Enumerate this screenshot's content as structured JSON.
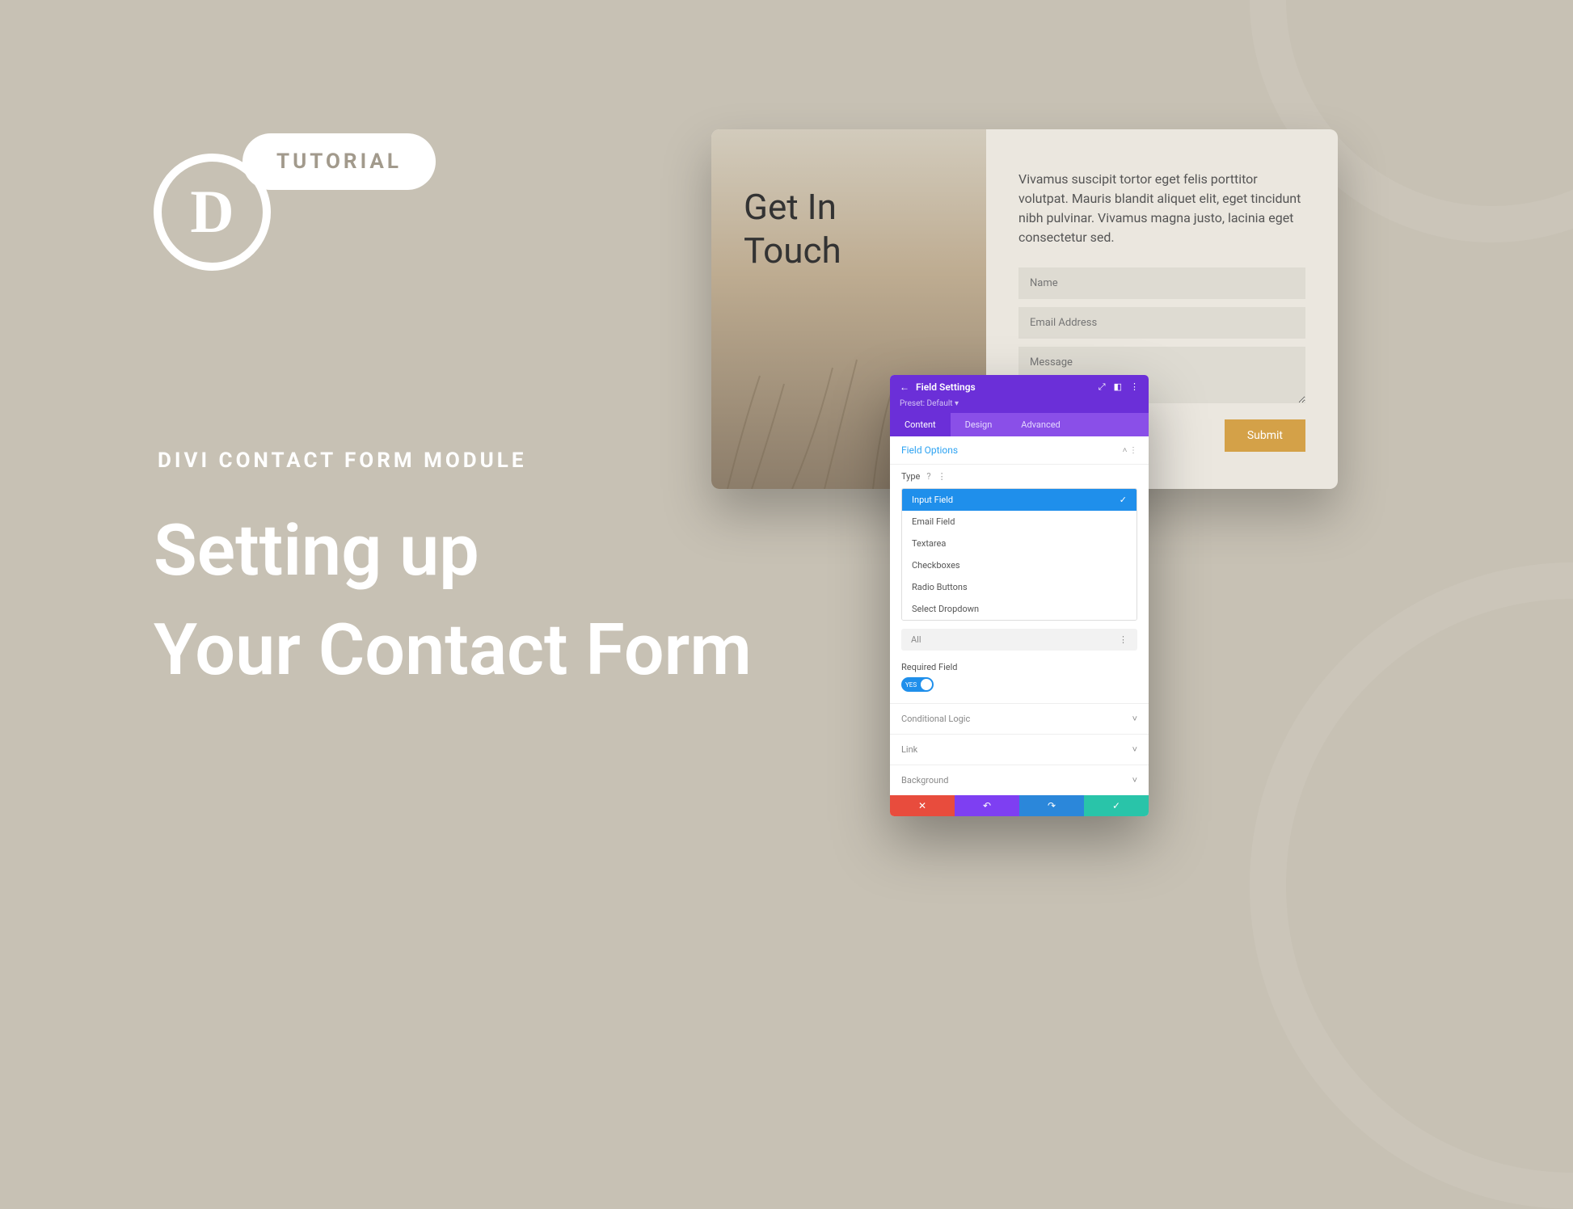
{
  "badge": "TUTORIAL",
  "subheading": "DIVI CONTACT FORM MODULE",
  "heading_line1": "Setting up",
  "heading_line2": "Your Contact Form",
  "card": {
    "title_line1": "Get In",
    "title_line2": "Touch",
    "desc": "Vivamus suscipit tortor eget felis porttitor volutpat. Mauris blandit aliquet elit, eget tincidunt nibh pulvinar. Vivamus magna justo, lacinia eget consectetur sed.",
    "name_ph": "Name",
    "email_ph": "Email Address",
    "msg_ph": "Message",
    "submit": "Submit"
  },
  "panel": {
    "title": "Field Settings",
    "preset": "Preset: Default",
    "tabs": {
      "content": "Content",
      "design": "Design",
      "advanced": "Advanced"
    },
    "section": "Field Options",
    "type_label": "Type",
    "help": "?",
    "options": {
      "input": "Input Field",
      "email": "Email Field",
      "textarea": "Textarea",
      "checkboxes": "Checkboxes",
      "radio": "Radio Buttons",
      "select": "Select Dropdown"
    },
    "all": "All",
    "required": "Required Field",
    "yes": "YES",
    "collapsed": {
      "conditional": "Conditional Logic",
      "link": "Link",
      "background": "Background"
    }
  }
}
